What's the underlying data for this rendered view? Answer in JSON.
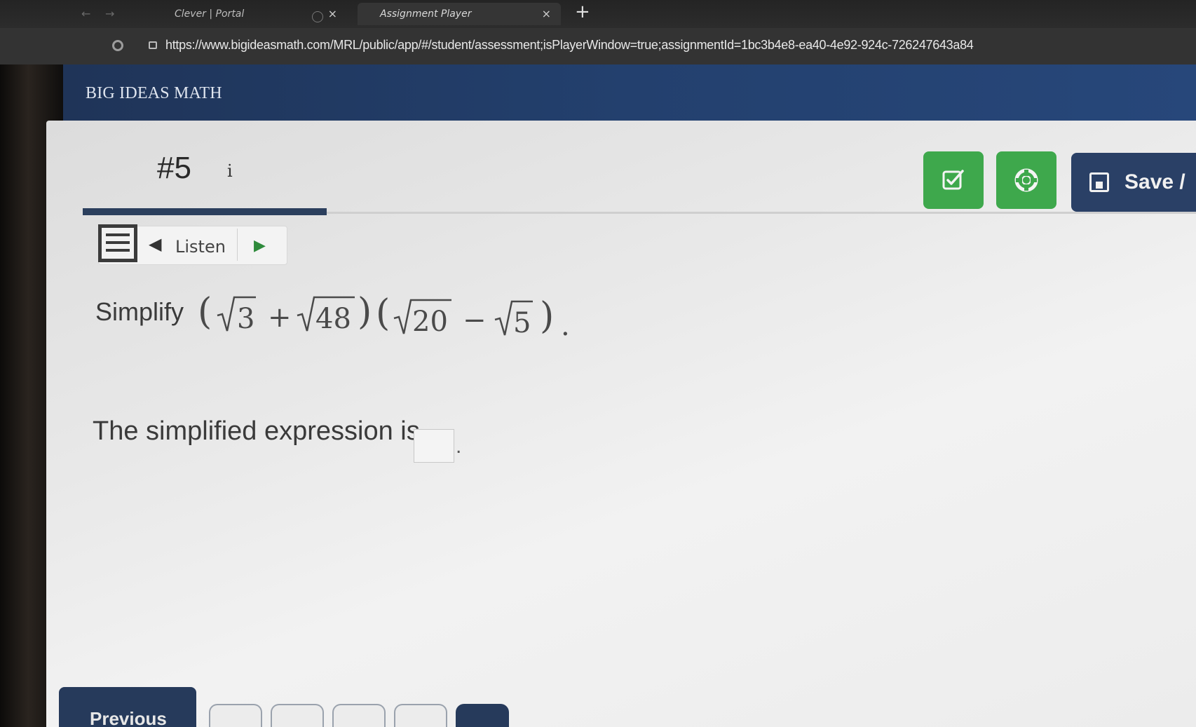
{
  "browser": {
    "tabs": [
      {
        "title": "Clever | Portal",
        "close": "×"
      },
      {
        "title": "Assignment Player",
        "close": "×"
      }
    ],
    "new_tab": "+",
    "url": "https://www.bigideasmath.com/MRL/public/app/#/student/assessment;isPlayerWindow=true;assignmentId=1bc3b4e8-ea40-4e92-924c-726247643a84"
  },
  "app": {
    "brand": "BIG IDEAS MATH"
  },
  "question": {
    "number": "#5",
    "info": "i",
    "toolbar": {
      "listen_label": "Listen",
      "speaker_glyph": "◀",
      "play_glyph": "▶"
    },
    "actions": {
      "save_label": "Save /"
    },
    "prompt_label": "Simplify",
    "math": {
      "open1": "(",
      "rad1": "3",
      "plus": "+",
      "rad2": "48",
      "close1": ")",
      "open2": "(",
      "rad3": "20",
      "minus": "−",
      "rad4": "5",
      "close2": ")",
      "period": "."
    },
    "answer_prompt": "The simplified expression is",
    "answer_value": "",
    "answer_period": "."
  },
  "nav": {
    "previous_label": "Previous"
  },
  "colors": {
    "header_blue": "#23406e",
    "action_green": "#3ea84c",
    "save_navy": "#2a4066"
  }
}
